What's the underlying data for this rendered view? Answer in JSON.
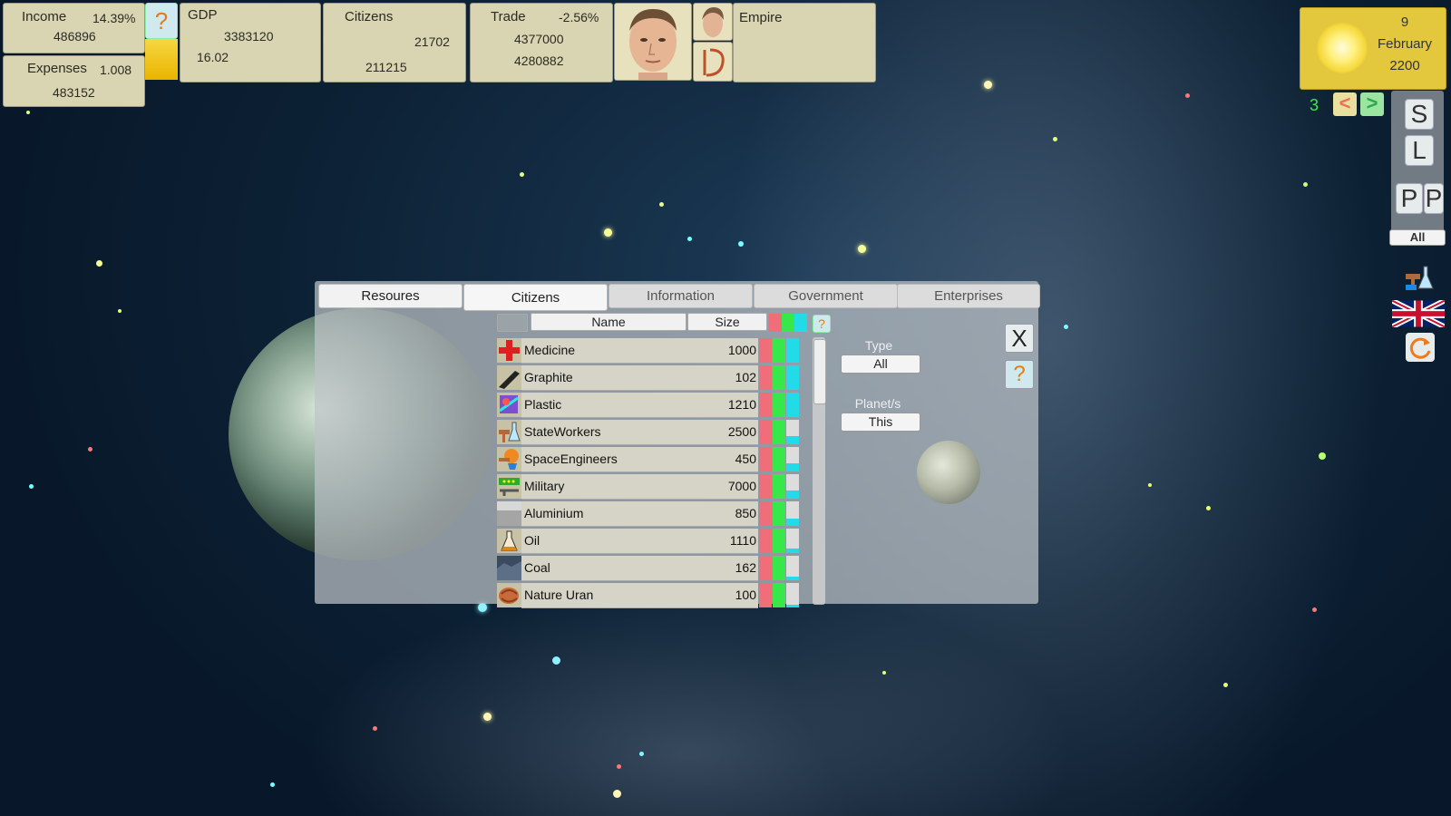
{
  "hud": {
    "income_label": "Income",
    "income_pct": "14.39%",
    "income_value": "486896",
    "expenses_label": "Expenses",
    "expenses_ratio": "1.008",
    "expenses_value": "483152",
    "help_symbol": "?",
    "gdp_label": "GDP",
    "gdp_value": "3383120",
    "gdp_sub": "16.02",
    "citizens_label": "Citizens",
    "citizens_value1": "21702",
    "citizens_value2": "211215",
    "trade_label": "Trade",
    "trade_pct": "-2.56%",
    "trade_value1": "4377000",
    "trade_value2": "4280882",
    "empire_label": "Empire"
  },
  "date": {
    "day": "9",
    "month": "February",
    "year": "2200"
  },
  "nav": {
    "speed": "3",
    "prev": "<",
    "next": ">"
  },
  "side": {
    "save": "S",
    "load": "L",
    "p1": "P",
    "p2": "P",
    "all": "All"
  },
  "tabs": {
    "resources": "Resoures",
    "citizens": "Citizens",
    "information": "Information",
    "government": "Government",
    "enterprises": "Enterprises"
  },
  "table": {
    "name_header": "Name",
    "size_header": "Size",
    "help": "?",
    "rows": [
      {
        "name": "Medicine",
        "size": "1000",
        "icon": "medicine-icon",
        "green": 1.0,
        "cyan": 1.0
      },
      {
        "name": "Graphite",
        "size": "102",
        "icon": "graphite-icon",
        "green": 1.0,
        "cyan": 1.0
      },
      {
        "name": "Plastic",
        "size": "1210",
        "icon": "plastic-icon",
        "green": 1.0,
        "cyan": 1.0
      },
      {
        "name": "StateWorkers",
        "size": "2500",
        "icon": "state-workers-icon",
        "green": 1.0,
        "cyan": 0.35
      },
      {
        "name": "SpaceEngineers",
        "size": "450",
        "icon": "space-engineers-icon",
        "green": 1.0,
        "cyan": 0.35
      },
      {
        "name": "Military",
        "size": "7000",
        "icon": "military-icon",
        "green": 1.0,
        "cyan": 0.35
      },
      {
        "name": "Aluminium",
        "size": "850",
        "icon": "aluminium-icon",
        "green": 1.0,
        "cyan": 0.3
      },
      {
        "name": "Oil",
        "size": "1110",
        "icon": "oil-icon",
        "green": 1.0,
        "cyan": 0.2
      },
      {
        "name": "Coal",
        "size": "162",
        "icon": "coal-icon",
        "green": 1.0,
        "cyan": 0.15
      },
      {
        "name": "Nature Uran",
        "size": "100",
        "icon": "uranium-icon",
        "green": 1.0,
        "cyan": 0.1
      }
    ]
  },
  "filters": {
    "type_label": "Type",
    "type_value": "All",
    "planet_label": "Planet/s",
    "planet_value": "This"
  },
  "window": {
    "close": "X",
    "help": "?"
  },
  "colors": {
    "red": "#ef6e7a",
    "green": "#38e84a",
    "cyan": "#22dbe8",
    "panel": "#d9d5b3"
  }
}
